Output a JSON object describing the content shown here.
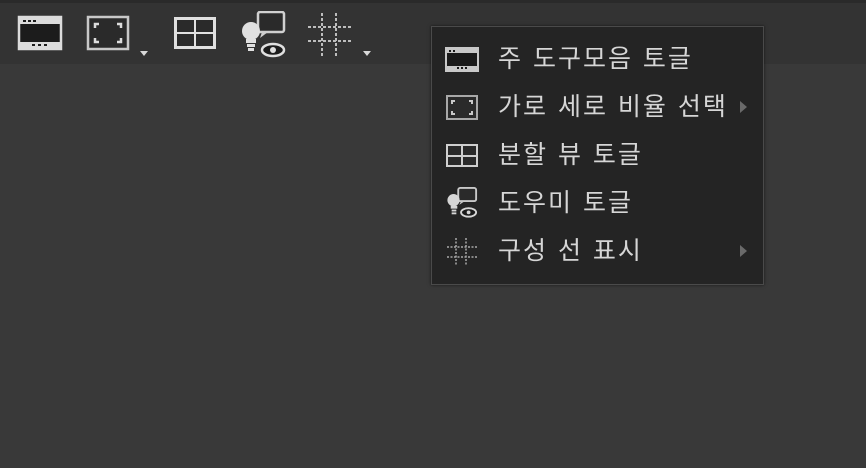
{
  "toolbar": {
    "buttons": [
      {
        "icon": "main-toolbar-icon",
        "has_dropdown": false
      },
      {
        "icon": "aspect-ratio-icon",
        "has_dropdown": true
      },
      {
        "icon": "split-view-icon",
        "has_dropdown": false
      },
      {
        "icon": "helper-icon",
        "has_dropdown": false
      },
      {
        "icon": "composition-lines-icon",
        "has_dropdown": true
      }
    ]
  },
  "menu": {
    "items": [
      {
        "label": "주 도구모음 토글",
        "icon": "main-toolbar-icon",
        "has_submenu": false
      },
      {
        "label": "가로 세로 비율 선택",
        "icon": "aspect-ratio-icon",
        "has_submenu": true
      },
      {
        "label": "분할 뷰 토글",
        "icon": "split-view-icon",
        "has_submenu": false
      },
      {
        "label": "도우미 토글",
        "icon": "helper-icon",
        "has_submenu": false
      },
      {
        "label": "구성 선 표시",
        "icon": "composition-lines-icon",
        "has_submenu": true
      }
    ]
  },
  "colors": {
    "background": "#393939",
    "toolbar": "#333333",
    "menu_background": "#242424",
    "text": "#d6d6d6",
    "icon": "#d9d9d9"
  }
}
